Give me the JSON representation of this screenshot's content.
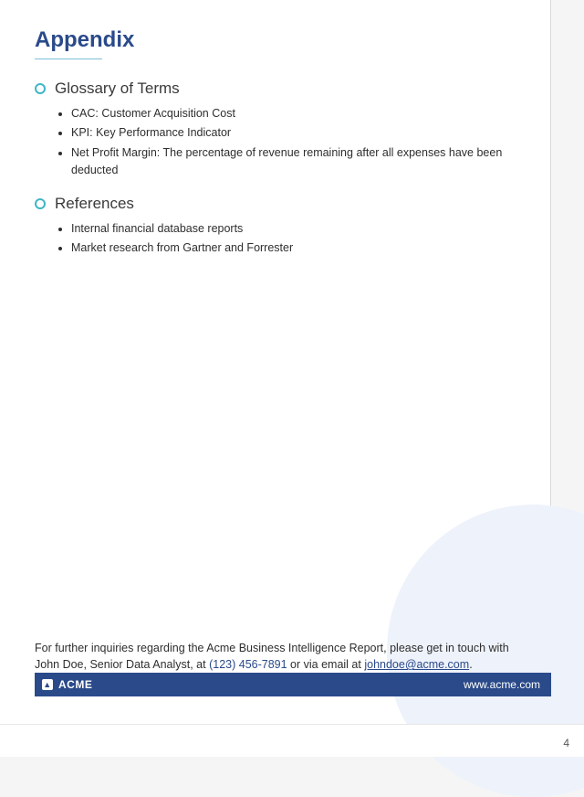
{
  "title": "Appendix",
  "sections": [
    {
      "heading": "Glossary of Terms",
      "items": [
        "CAC: Customer Acquisition Cost",
        "KPI: Key Performance Indicator",
        "Net Profit Margin: The percentage of revenue remaining after all expenses have been deducted"
      ]
    },
    {
      "heading": "References",
      "items": [
        "Internal financial database reports",
        "Market research from Gartner and Forrester"
      ]
    }
  ],
  "contact": {
    "pre": "For further inquiries regarding the Acme Business Intelligence Report, please get in touch with John Doe, Senior Data Analyst, at ",
    "phone": "(123) 456-7891",
    "mid": " or via email at ",
    "email": "johndoe@acme.com",
    "post": "."
  },
  "footer": {
    "brand_glyph": "▲",
    "brand": "ACME",
    "site": "www.acme.com"
  },
  "page_number": "4"
}
